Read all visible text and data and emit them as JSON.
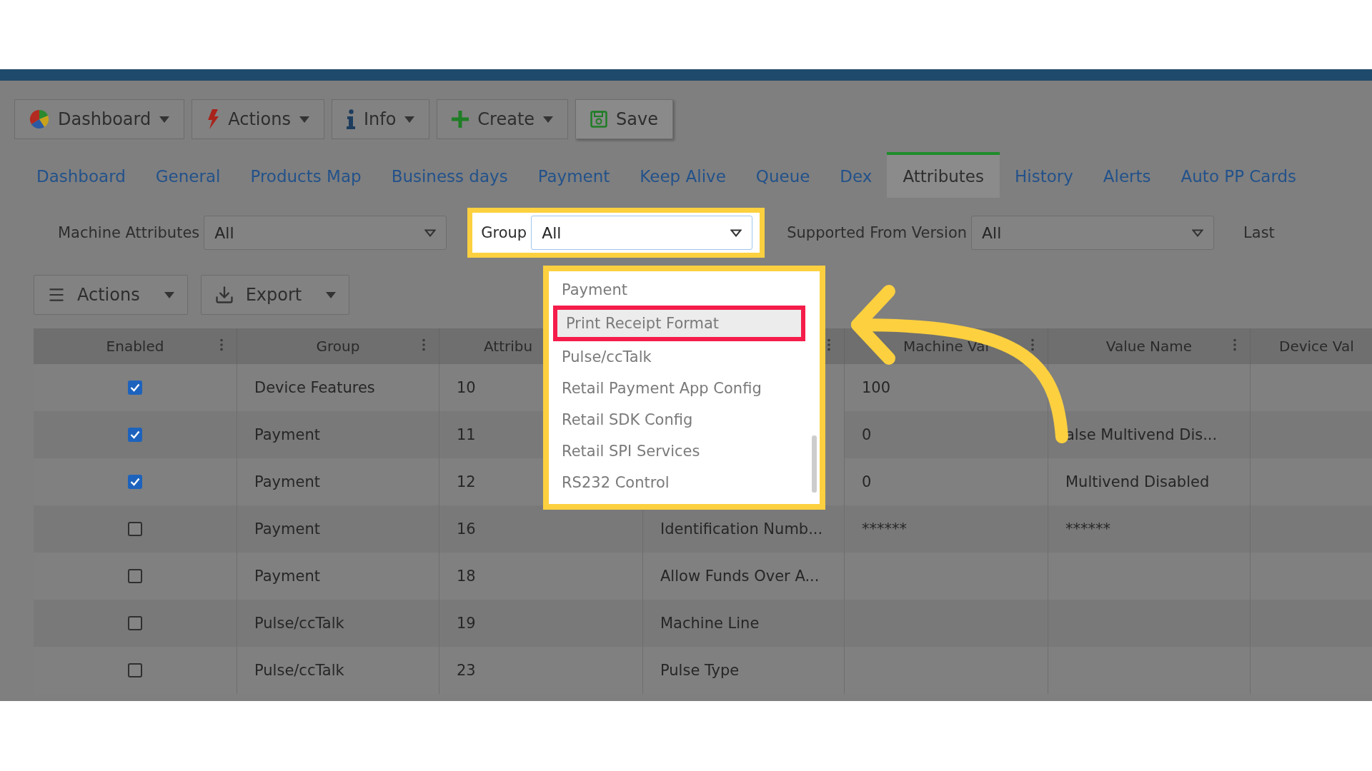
{
  "toolbar": [
    {
      "label": "Dashboard",
      "kind": "dashboard",
      "dropdown": true
    },
    {
      "label": "Actions",
      "kind": "bolt",
      "dropdown": true
    },
    {
      "label": "Info",
      "kind": "info",
      "dropdown": true
    },
    {
      "label": "Create",
      "kind": "plus",
      "dropdown": true
    },
    {
      "label": "Save",
      "kind": "save",
      "dropdown": false
    }
  ],
  "tabs": [
    {
      "label": "Dashboard",
      "selected": false
    },
    {
      "label": "General",
      "selected": false
    },
    {
      "label": "Products Map",
      "selected": false
    },
    {
      "label": "Business days",
      "selected": false
    },
    {
      "label": "Payment",
      "selected": false
    },
    {
      "label": "Keep Alive",
      "selected": false
    },
    {
      "label": "Queue",
      "selected": false
    },
    {
      "label": "Dex",
      "selected": false
    },
    {
      "label": "Attributes",
      "selected": true
    },
    {
      "label": "History",
      "selected": false
    },
    {
      "label": "Alerts",
      "selected": false
    },
    {
      "label": "Auto PP Cards",
      "selected": false
    }
  ],
  "filters": [
    {
      "label": "Machine Attributes",
      "value": "All",
      "annotated": false
    },
    {
      "label": "Group",
      "value": "All",
      "annotated": true
    },
    {
      "label": "Supported From Version",
      "value": "All",
      "annotated": false
    }
  ],
  "filter_cut_label": "Last",
  "group_options": [
    {
      "label": "Payment",
      "selected": false
    },
    {
      "label": "Print Receipt Format",
      "selected": true
    },
    {
      "label": "Pulse/ccTalk",
      "selected": false
    },
    {
      "label": "Retail Payment App Config",
      "selected": false
    },
    {
      "label": "Retail SDK Config",
      "selected": false
    },
    {
      "label": "Retail SPI Services",
      "selected": false
    },
    {
      "label": "RS232 Control",
      "selected": false
    }
  ],
  "grid_actions": [
    {
      "label": "Actions",
      "kind": "menu"
    },
    {
      "label": "Export",
      "kind": "export"
    }
  ],
  "table": {
    "columns": [
      {
        "label": "Enabled"
      },
      {
        "label": "Group"
      },
      {
        "label": "Attribu"
      },
      {},
      {
        "label": "Machine Val"
      },
      {
        "label": "Value Name"
      },
      {
        "label": "Device Val"
      }
    ],
    "rows": [
      {
        "enabled": true,
        "group": "Device Features",
        "attribute": "10",
        "machine_value": "100"
      },
      {
        "enabled": true,
        "group": "Payment",
        "attribute": "11",
        "machine_value": "0",
        "value_name": "alse Multivend Dis..."
      },
      {
        "enabled": true,
        "group": "Payment",
        "attribute": "12",
        "machine_value": "0",
        "value_name": "Multivend Disabled"
      },
      {
        "enabled": false,
        "group": "Payment",
        "attribute": "16",
        "column_4": "Identification Numb...",
        "machine_value": "******",
        "value_name": "******"
      },
      {
        "enabled": false,
        "group": "Payment",
        "attribute": "18",
        "column_4": "Allow Funds Over A..."
      },
      {
        "enabled": false,
        "group": "Pulse/ccTalk",
        "attribute": "19",
        "column_4": "Machine Line"
      },
      {
        "enabled": false,
        "group": "Pulse/ccTalk",
        "attribute": "23",
        "column_4": "Pulse Type"
      }
    ]
  }
}
